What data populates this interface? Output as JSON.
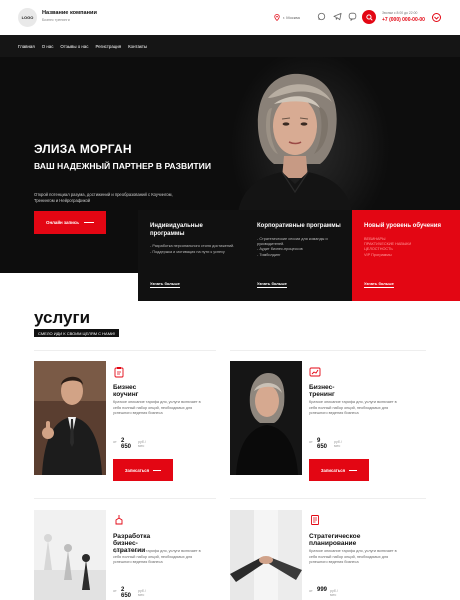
{
  "header": {
    "logo": "LOGO",
    "company_name": "Название компании",
    "company_sub": "Бизнес тренинги",
    "location": "г. Москва",
    "phone_label": "Звонки с 8:00 до 22:00",
    "phone_number": "+7 (000) 000-00-00"
  },
  "nav": [
    "Главная",
    "О нас",
    "Отзывы о нас",
    "Регистрация",
    "Контакты"
  ],
  "hero": {
    "title": "ЭЛИЗА МОРГАН",
    "subtitle": "ВАШ НАДЕЖНЫЙ ПАРТНЕР В РАЗВИТИИ",
    "description": "Открой потенциал разума, достижений и преобразований с Коучингом, Тренингом и Нейрографикой",
    "button": "Онлайн запись"
  },
  "programs": [
    {
      "title": "Индивидуальные программы",
      "items": [
        "- Разработка персонального стиля достижений.",
        "- Поддержка и мотивация на пути к успеху"
      ],
      "link": "Узнать больше"
    },
    {
      "title": "Корпоративные программы",
      "items": [
        "- Стратегические сессии для команды и руководителей.",
        "- Аудит бизнес-процессов",
        "- Тимбилдинг"
      ],
      "link": "Узнать больше"
    },
    {
      "title": "Новый уровень обучения",
      "items": [
        "ВЕБИНАРЫ",
        "ПРАКТИЧЕСКИЕ НАВЫКИ",
        "ЦЕЛОСТНОСТЬ",
        "VIP Программы"
      ],
      "link": "Узнать больше"
    }
  ],
  "services": {
    "title": "услуги",
    "tagline": "СМЕЛО ИДИ К СВОИМ ЦЕЛЯМ С НАМИ!",
    "cards": [
      {
        "title": "Бизнес коучинг",
        "icon": "clipboard-icon",
        "description": "Краткое описание тарифа для, услуги включает в себя полный набор опций, необходимых для успешного ведения бизнеса",
        "from": "от",
        "price": "2 650",
        "unit": "руб./мес",
        "button": "Записаться"
      },
      {
        "title": "Бизнес-тренинг",
        "icon": "chart-icon",
        "description": "Краткое описание тарифа для, услуги включает в себя полный набор опций, необходимых для успешного ведения бизнеса",
        "from": "от",
        "price": "9 650",
        "unit": "руб./мес",
        "button": "Записаться"
      },
      {
        "title": "Разработка бизнес-стратегии",
        "icon": "strategy-icon",
        "description": "Краткое описание тарифа для, услуги включает в себя полный набор опций, необходимых для успешного ведения бизнеса",
        "from": "от",
        "price": "2 650",
        "unit": "руб./мес",
        "button": "Записаться"
      },
      {
        "title": "Стратегическое планирование",
        "icon": "document-icon",
        "description": "Краткое описание тарифа для, услуги включает в себя полный набор опций, необходимых для успешного ведения бизнеса",
        "from": "от",
        "price": "999",
        "unit": "руб./мес",
        "button": "Записаться"
      }
    ]
  },
  "colors": {
    "accent": "#e30613",
    "dark": "#111111",
    "hero_bg": "#0d0d0d"
  }
}
